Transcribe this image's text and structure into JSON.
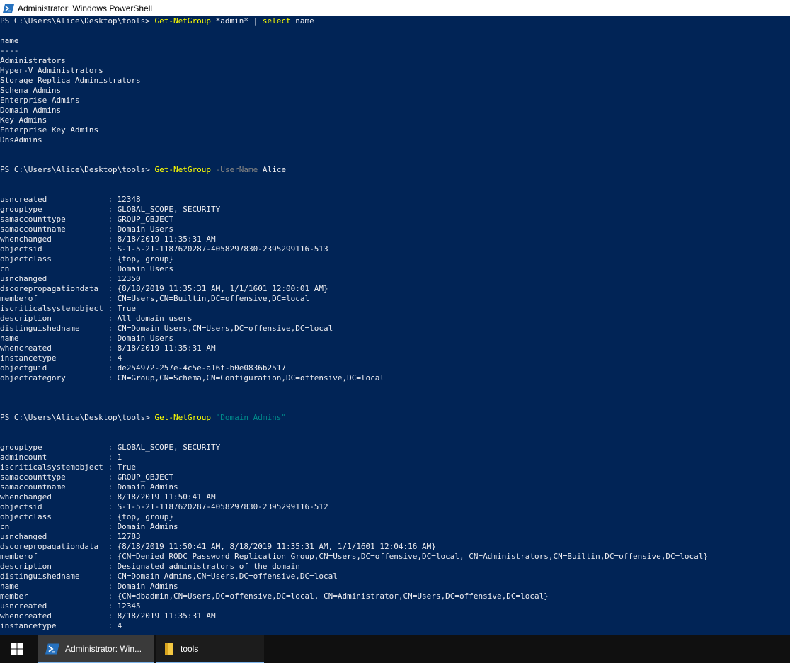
{
  "window": {
    "title": "Administrator: Windows PowerShell"
  },
  "console": {
    "lines": [
      [
        {
          "t": "PS C:\\Users\\Alice\\Desktop\\tools> "
        },
        {
          "t": "Get-NetGroup",
          "c": "cmd"
        },
        {
          "t": " *admin* | "
        },
        {
          "t": "select",
          "c": "cmd"
        },
        {
          "t": " name"
        }
      ],
      [],
      [
        {
          "t": "name"
        }
      ],
      [
        {
          "t": "----"
        }
      ],
      [
        {
          "t": "Administrators"
        }
      ],
      [
        {
          "t": "Hyper-V Administrators"
        }
      ],
      [
        {
          "t": "Storage Replica Administrators"
        }
      ],
      [
        {
          "t": "Schema Admins"
        }
      ],
      [
        {
          "t": "Enterprise Admins"
        }
      ],
      [
        {
          "t": "Domain Admins"
        }
      ],
      [
        {
          "t": "Key Admins"
        }
      ],
      [
        {
          "t": "Enterprise Key Admins"
        }
      ],
      [
        {
          "t": "DnsAdmins"
        }
      ],
      [],
      [],
      [
        {
          "t": "PS C:\\Users\\Alice\\Desktop\\tools> "
        },
        {
          "t": "Get-NetGroup",
          "c": "cmd"
        },
        {
          "t": " "
        },
        {
          "t": "-UserName",
          "c": "param"
        },
        {
          "t": " Alice"
        }
      ],
      [],
      [],
      [
        {
          "t": "usncreated             : 12348"
        }
      ],
      [
        {
          "t": "grouptype              : GLOBAL_SCOPE, SECURITY"
        }
      ],
      [
        {
          "t": "samaccounttype         : GROUP_OBJECT"
        }
      ],
      [
        {
          "t": "samaccountname         : Domain Users"
        }
      ],
      [
        {
          "t": "whenchanged            : 8/18/2019 11:35:31 AM"
        }
      ],
      [
        {
          "t": "objectsid              : S-1-5-21-1187620287-4058297830-2395299116-513"
        }
      ],
      [
        {
          "t": "objectclass            : {top, group}"
        }
      ],
      [
        {
          "t": "cn                     : Domain Users"
        }
      ],
      [
        {
          "t": "usnchanged             : 12350"
        }
      ],
      [
        {
          "t": "dscorepropagationdata  : {8/18/2019 11:35:31 AM, 1/1/1601 12:00:01 AM}"
        }
      ],
      [
        {
          "t": "memberof               : CN=Users,CN=Builtin,DC=offensive,DC=local"
        }
      ],
      [
        {
          "t": "iscriticalsystemobject : True"
        }
      ],
      [
        {
          "t": "description            : All domain users"
        }
      ],
      [
        {
          "t": "distinguishedname      : CN=Domain Users,CN=Users,DC=offensive,DC=local"
        }
      ],
      [
        {
          "t": "name                   : Domain Users"
        }
      ],
      [
        {
          "t": "whencreated            : 8/18/2019 11:35:31 AM"
        }
      ],
      [
        {
          "t": "instancetype           : 4"
        }
      ],
      [
        {
          "t": "objectguid             : de254972-257e-4c5e-a16f-b0e0836b2517"
        }
      ],
      [
        {
          "t": "objectcategory         : CN=Group,CN=Schema,CN=Configuration,DC=offensive,DC=local"
        }
      ],
      [],
      [],
      [],
      [
        {
          "t": "PS C:\\Users\\Alice\\Desktop\\tools> "
        },
        {
          "t": "Get-NetGroup",
          "c": "cmd"
        },
        {
          "t": " "
        },
        {
          "t": "\"Domain Admins\"",
          "c": "str"
        }
      ],
      [],
      [],
      [
        {
          "t": "grouptype              : GLOBAL_SCOPE, SECURITY"
        }
      ],
      [
        {
          "t": "admincount             : 1"
        }
      ],
      [
        {
          "t": "iscriticalsystemobject : True"
        }
      ],
      [
        {
          "t": "samaccounttype         : GROUP_OBJECT"
        }
      ],
      [
        {
          "t": "samaccountname         : Domain Admins"
        }
      ],
      [
        {
          "t": "whenchanged            : 8/18/2019 11:50:41 AM"
        }
      ],
      [
        {
          "t": "objectsid              : S-1-5-21-1187620287-4058297830-2395299116-512"
        }
      ],
      [
        {
          "t": "objectclass            : {top, group}"
        }
      ],
      [
        {
          "t": "cn                     : Domain Admins"
        }
      ],
      [
        {
          "t": "usnchanged             : 12783"
        }
      ],
      [
        {
          "t": "dscorepropagationdata  : {8/18/2019 11:50:41 AM, 8/18/2019 11:35:31 AM, 1/1/1601 12:04:16 AM}"
        }
      ],
      [
        {
          "t": "memberof               : {CN=Denied RODC Password Replication Group,CN=Users,DC=offensive,DC=local, CN=Administrators,CN=Builtin,DC=offensive,DC=local}"
        }
      ],
      [
        {
          "t": "description            : Designated administrators of the domain"
        }
      ],
      [
        {
          "t": "distinguishedname      : CN=Domain Admins,CN=Users,DC=offensive,DC=local"
        }
      ],
      [
        {
          "t": "name                   : Domain Admins"
        }
      ],
      [
        {
          "t": "member                 : {CN=dbadmin,CN=Users,DC=offensive,DC=local, CN=Administrator,CN=Users,DC=offensive,DC=local}"
        }
      ],
      [
        {
          "t": "usncreated             : 12345"
        }
      ],
      [
        {
          "t": "whencreated            : 8/18/2019 11:35:31 AM"
        }
      ],
      [
        {
          "t": "instancetype           : 4"
        }
      ]
    ]
  },
  "taskbar": {
    "items": [
      {
        "label": "Administrator: Win...",
        "icon": "powershell-icon",
        "active": true
      },
      {
        "label": "tools",
        "icon": "folder-icon",
        "active": false
      }
    ]
  },
  "colors": {
    "console_bg": "#012456",
    "console_fg": "#eeedf0",
    "cmdlet": "#ffff00",
    "parameter": "#808080",
    "string": "#008b8b",
    "taskbar_bg": "#101010",
    "active_underline": "#7eb4ea"
  }
}
